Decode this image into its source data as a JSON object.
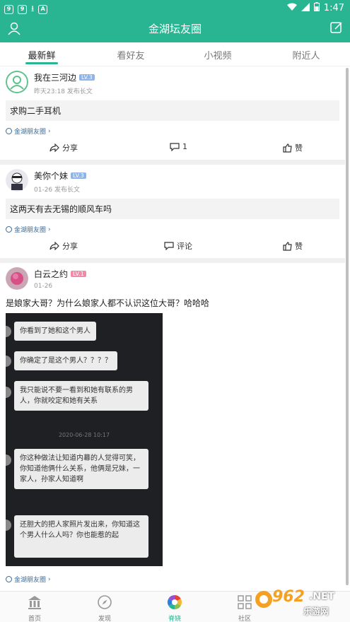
{
  "status_bar": {
    "time": "1:47"
  },
  "app_bar": {
    "title": "金湖坛友圈"
  },
  "tabs": [
    "最新鲜",
    "看好友",
    "小视频",
    "附近人"
  ],
  "posts": [
    {
      "name": "我在三河边",
      "level": "LV.3",
      "meta": "昨天23:18  发布长文",
      "text": "求购二手耳机",
      "circle": "金湖朋友圈",
      "share": "分享",
      "comment": "1",
      "like": "赞"
    },
    {
      "name": "美你个妹",
      "level": "LV.3",
      "meta": "01-26  发布长文",
      "text": "这两天有去无锡的顺风车吗",
      "circle": "金湖朋友圈",
      "share": "分享",
      "comment": "评论",
      "like": "赞"
    },
    {
      "name": "白云之约",
      "level": "LV.1",
      "meta": "01-26",
      "text": "是娘家大哥？为什么娘家人都不认识这位大哥？哈哈哈",
      "circle": "金湖朋友圈",
      "chat": [
        "你看到了她和这个男人",
        "你确定了是这个男人？？？？",
        "我只能说不要一看到和她有联系的男人，你就咬定和她有关系",
        "2020-06-28 10:17",
        "你这种做法让知道内幕的人觉得可笑，你知道他俩什么关系，他俩是兄妹，一家人，孙家人知道啊",
        "还胆大的把人家照片发出来，你知道这个男人什么人吗？你也能惹的起"
      ]
    }
  ],
  "bottom_nav": [
    "首页",
    "发现",
    "脊娆",
    "社区"
  ],
  "watermark": {
    "num": "962",
    "net": ".NET",
    "text": "乐游网"
  },
  "colors": {
    "accent": "#2ab592",
    "lv_blue": "#8fb4e8",
    "lv_pink": "#f08aa8"
  }
}
